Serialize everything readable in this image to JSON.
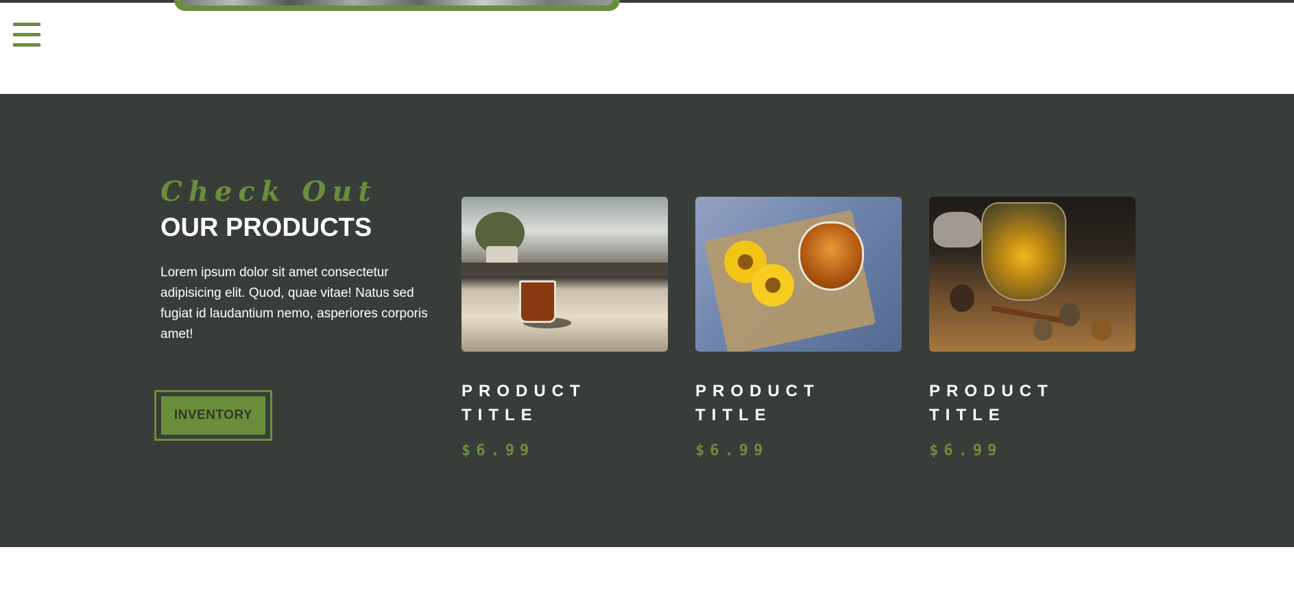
{
  "header": {
    "menu_icon": "hamburger-menu-icon",
    "accent_color": "#6b8e3c"
  },
  "products_section": {
    "background_color": "#393d39",
    "script_heading": "Check Out",
    "heading": "OUR PRODUCTS",
    "description": "Lorem ipsum dolor sit amet consectetur adipisicing elit. Quod, quae vitae! Natus sed fugiat id laudantium nemo, asperiores corporis amet!",
    "button_label": "INVENTORY",
    "products": [
      {
        "title": "PRODUCT TITLE",
        "price": "$6.99",
        "image": "tea-glass-on-table"
      },
      {
        "title": "PRODUCT TITLE",
        "price": "$6.99",
        "image": "tea-cup-with-yellow-flowers"
      },
      {
        "title": "PRODUCT TITLE",
        "price": "$6.99",
        "image": "flowering-tea-in-glass-pot"
      }
    ]
  }
}
